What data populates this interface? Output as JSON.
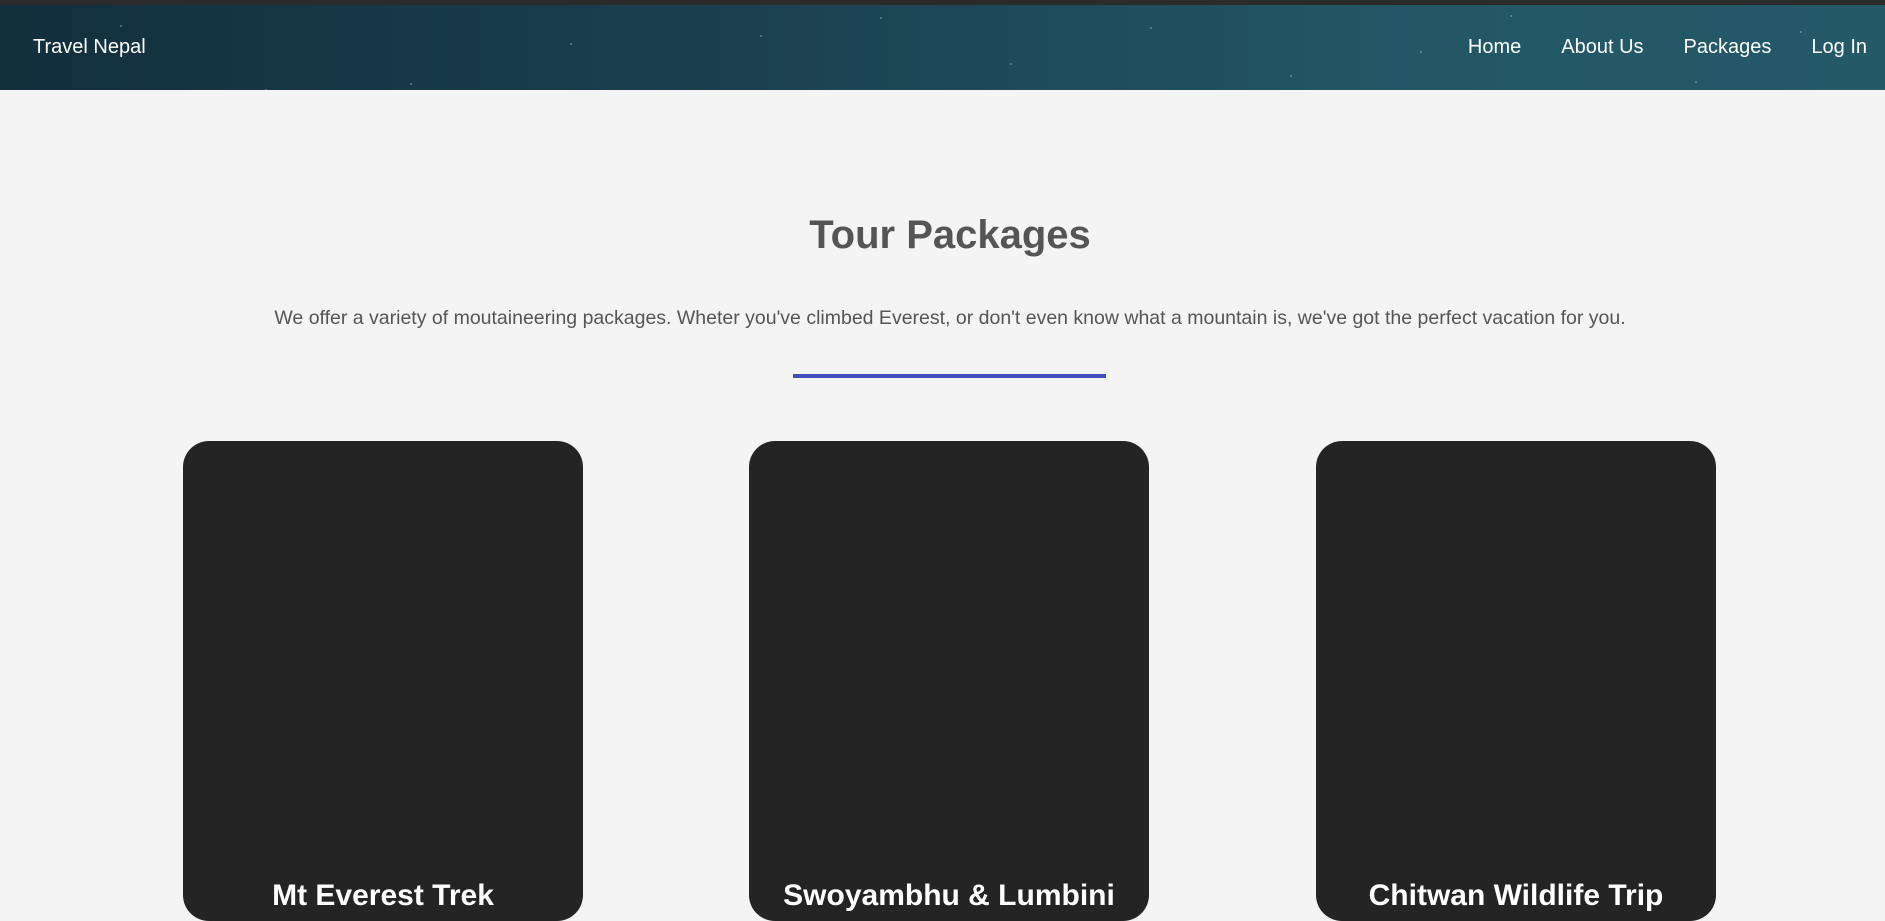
{
  "header": {
    "brand": "Travel Nepal",
    "nav": [
      "Home",
      "About Us",
      "Packages",
      "Log In"
    ]
  },
  "main": {
    "title": "Tour Packages",
    "subtitle": "We offer a variety of moutaineering packages. Wheter you've climbed Everest, or don't even know what a mountain is, we've got the perfect vacation for you.",
    "accent_color": "#3f51b5",
    "packages": [
      {
        "name": "Mt Everest Trek"
      },
      {
        "name": "Swoyambhu & Lumbini"
      },
      {
        "name": "Chitwan Wildlife Trip"
      }
    ]
  }
}
